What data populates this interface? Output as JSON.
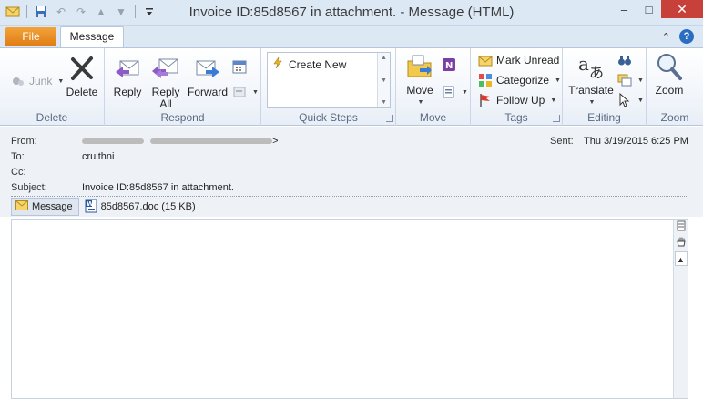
{
  "window": {
    "title": "Invoice ID:85d8567 in attachment.  -  Message (HTML)",
    "minimize": "–",
    "maximize": "□",
    "close": "✕"
  },
  "tabs": {
    "file": "File",
    "message": "Message"
  },
  "ribbon": {
    "delete_group": {
      "label": "Delete",
      "junk": "Junk",
      "delete": "Delete"
    },
    "respond_group": {
      "label": "Respond",
      "reply": "Reply",
      "reply_all_1": "Reply",
      "reply_all_2": "All",
      "forward": "Forward"
    },
    "quick_steps_group": {
      "label": "Quick Steps",
      "create_new": "Create New"
    },
    "move_group": {
      "label": "Move",
      "move": "Move"
    },
    "tags_group": {
      "label": "Tags",
      "mark_unread": "Mark Unread",
      "categorize": "Categorize",
      "follow_up": "Follow Up"
    },
    "editing_group": {
      "label": "Editing",
      "translate": "Translate"
    },
    "zoom_group": {
      "label": "Zoom",
      "zoom": "Zoom"
    }
  },
  "header": {
    "from_label": "From:",
    "from_end": ">",
    "to_label": "To:",
    "to_value": "cruithni",
    "cc_label": "Cc:",
    "subject_label": "Subject:",
    "subject_value": "Invoice ID:85d8567 in attachment.",
    "sent_label": "Sent:",
    "sent_value": "Thu 3/19/2015 6:25 PM"
  },
  "attachments": {
    "message_tab": "Message",
    "file_name": "85d8567.doc (15 KB)"
  },
  "colors": {
    "file_tab": "#e07b14",
    "accent_blue": "#2a6dc1",
    "close_red": "#c7413a"
  }
}
